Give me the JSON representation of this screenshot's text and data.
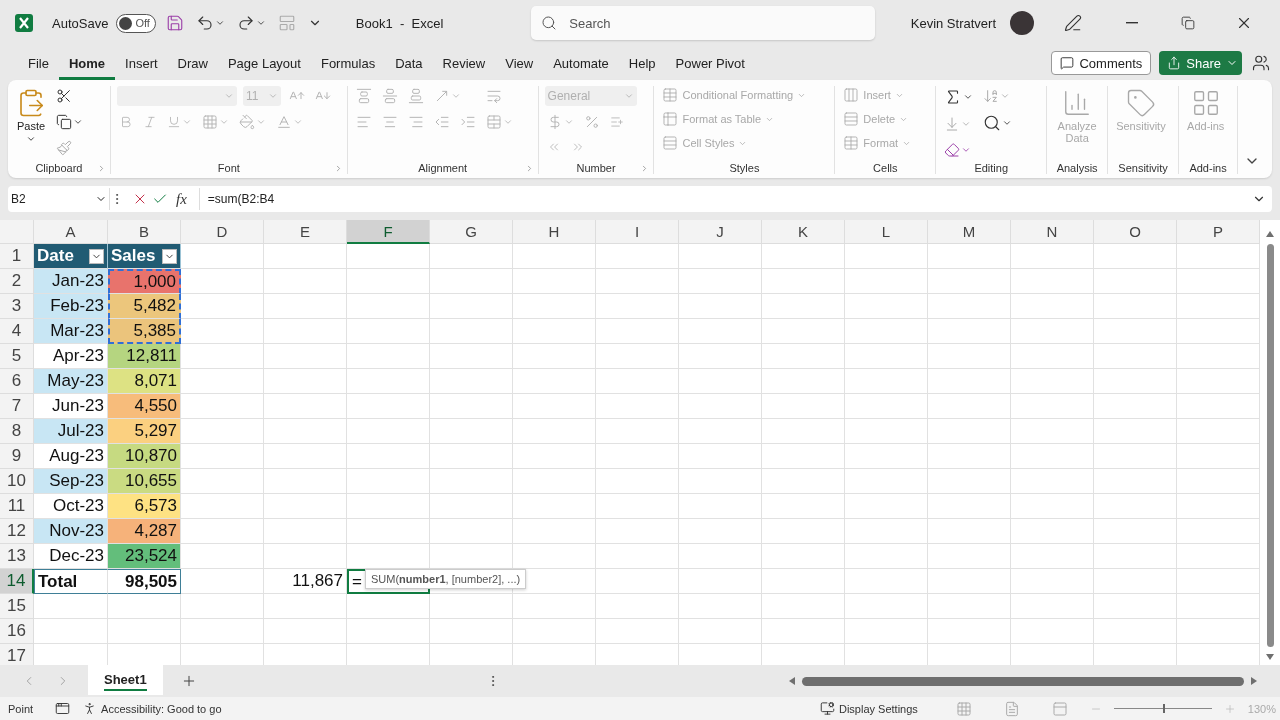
{
  "title_bar": {
    "autosave": {
      "label": "AutoSave",
      "on": false,
      "state": "Off"
    },
    "document_title": "Book1  -  Excel",
    "search": {
      "placeholder": "Search"
    },
    "user_name": "Kevin Stratvert"
  },
  "menu_tabs": [
    {
      "label": "File",
      "selected": false
    },
    {
      "label": "Home",
      "selected": true
    },
    {
      "label": "Insert",
      "selected": false
    },
    {
      "label": "Draw",
      "selected": false
    },
    {
      "label": "Page Layout",
      "selected": false
    },
    {
      "label": "Formulas",
      "selected": false
    },
    {
      "label": "Data",
      "selected": false
    },
    {
      "label": "Review",
      "selected": false
    },
    {
      "label": "View",
      "selected": false
    },
    {
      "label": "Automate",
      "selected": false
    },
    {
      "label": "Help",
      "selected": false
    },
    {
      "label": "Power Pivot",
      "selected": false
    }
  ],
  "comments_button": "Comments",
  "share_button": "Share",
  "ribbon": {
    "groups": [
      {
        "kind": "clipboard",
        "label": "Clipboard",
        "paste": "Paste",
        "disabled": false
      },
      {
        "kind": "font",
        "label": "Font",
        "font_size": "11",
        "disabled": true
      },
      {
        "kind": "alignment",
        "label": "Alignment",
        "disabled": true
      },
      {
        "kind": "number",
        "label": "Number",
        "format": "General",
        "disabled": true
      },
      {
        "kind": "list",
        "label": "Styles",
        "items": [
          {
            "label": "Conditional Formatting",
            "disabled": true
          },
          {
            "label": "Format as Table",
            "disabled": true
          },
          {
            "label": "Cell Styles",
            "disabled": true
          }
        ]
      },
      {
        "kind": "list",
        "label": "Cells",
        "items": [
          {
            "label": "Insert",
            "disabled": true
          },
          {
            "label": "Delete",
            "disabled": true
          },
          {
            "label": "Format",
            "disabled": true
          }
        ]
      },
      {
        "kind": "editing",
        "label": "Editing",
        "disabled": false
      },
      {
        "kind": "large",
        "label": "Analysis",
        "button": {
          "label": "Analyze Data",
          "disabled": true
        }
      },
      {
        "kind": "large",
        "label": "Sensitivity",
        "button": {
          "label": "Sensitivity",
          "disabled": true
        }
      },
      {
        "kind": "large",
        "label": "Add-ins",
        "button": {
          "label": "Add-ins",
          "disabled": true
        }
      }
    ]
  },
  "formula_bar": {
    "name_box": "B2",
    "function_label": "fx",
    "formula": "=sum(B2:B4"
  },
  "sheet": {
    "columns": [
      {
        "label": "A",
        "selected": false
      },
      {
        "label": "B",
        "selected": false
      },
      {
        "label": "D",
        "selected": false
      },
      {
        "label": "E",
        "selected": false
      },
      {
        "label": "F",
        "selected": true
      },
      {
        "label": "G",
        "selected": false
      },
      {
        "label": "H",
        "selected": false
      },
      {
        "label": "I",
        "selected": false
      },
      {
        "label": "J",
        "selected": false
      },
      {
        "label": "K",
        "selected": false
      },
      {
        "label": "L",
        "selected": false
      },
      {
        "label": "M",
        "selected": false
      },
      {
        "label": "N",
        "selected": false
      },
      {
        "label": "O",
        "selected": false
      },
      {
        "label": "P",
        "selected": false
      }
    ],
    "rows": [
      {
        "number": "1",
        "selected": false,
        "kind": "header",
        "cell_a": "Date",
        "cell_b": "Sales"
      },
      {
        "number": "2",
        "selected": false,
        "kind": "data",
        "cell_a": "Jan-23",
        "banded": true,
        "cell_b": "1,000",
        "color": "#e8736c",
        "referenced": true
      },
      {
        "number": "3",
        "selected": false,
        "kind": "data",
        "cell_a": "Feb-23",
        "banded": true,
        "cell_b": "5,482",
        "color": "#ecc67c",
        "referenced": true
      },
      {
        "number": "4",
        "selected": false,
        "kind": "data",
        "cell_a": "Mar-23",
        "banded": true,
        "cell_b": "5,385",
        "color": "#ebc47c",
        "referenced": true
      },
      {
        "number": "5",
        "selected": false,
        "kind": "data",
        "cell_a": "Apr-23",
        "banded": false,
        "cell_b": "12,811",
        "color": "#b5d580",
        "referenced": false
      },
      {
        "number": "6",
        "selected": false,
        "kind": "data",
        "cell_a": "May-23",
        "banded": true,
        "cell_b": "8,071",
        "color": "#dde283",
        "referenced": false
      },
      {
        "number": "7",
        "selected": false,
        "kind": "data",
        "cell_a": "Jun-23",
        "banded": false,
        "cell_b": "4,550",
        "color": "#f7bc7b",
        "referenced": false
      },
      {
        "number": "8",
        "selected": false,
        "kind": "data",
        "cell_a": "Jul-23",
        "banded": true,
        "cell_b": "5,297",
        "color": "#fbd080",
        "referenced": false
      },
      {
        "number": "9",
        "selected": false,
        "kind": "data",
        "cell_a": "Aug-23",
        "banded": false,
        "cell_b": "10,870",
        "color": "#c6da81",
        "referenced": false
      },
      {
        "number": "10",
        "selected": false,
        "kind": "data",
        "cell_a": "Sep-23",
        "banded": true,
        "cell_b": "10,655",
        "color": "#cadb82",
        "referenced": false
      },
      {
        "number": "11",
        "selected": false,
        "kind": "data",
        "cell_a": "Oct-23",
        "banded": false,
        "cell_b": "6,573",
        "color": "#fee283",
        "referenced": false
      },
      {
        "number": "12",
        "selected": false,
        "kind": "data",
        "cell_a": "Nov-23",
        "banded": true,
        "cell_b": "4,287",
        "color": "#f6b27a",
        "referenced": false
      },
      {
        "number": "13",
        "selected": false,
        "kind": "data",
        "cell_a": "Dec-23",
        "banded": false,
        "cell_b": "23,524",
        "color": "#63be7b",
        "referenced": false
      },
      {
        "number": "14",
        "selected": true,
        "kind": "total",
        "cell_a": "Total",
        "cell_b": "98,505",
        "cell_e": "11,867",
        "cell_f": "="
      },
      {
        "number": "15",
        "selected": false,
        "kind": "empty"
      },
      {
        "number": "16",
        "selected": false,
        "kind": "empty"
      },
      {
        "number": "17",
        "selected": false,
        "kind": "empty"
      }
    ],
    "tooltip": "SUM(**number1**, [number2], ...)"
  },
  "sheet_tabs": [
    {
      "label": "Sheet1",
      "selected": true
    }
  ],
  "status_bar": {
    "mode": "Point",
    "accessibility": "Accessibility: Good to go",
    "display_settings": "Display Settings",
    "zoom": {
      "level": 0.5,
      "label": "130%"
    }
  }
}
